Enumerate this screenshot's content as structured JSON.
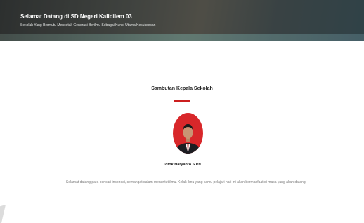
{
  "hero": {
    "title": "Selamat Datang di SD Negeri Kalidilem 03",
    "subtitle": "Sekolah Yang Bermutu Mencetak Generasi Berilmu Sebagai Kunci Utama Kesuksesan"
  },
  "principal_section": {
    "title": "Sambutan Kepala Sekolah",
    "name": "Totok Haryanto S.Pd",
    "message": "Selamat datang para pencari inspirasi, semangat dalam menuntut ilmu. Kelak ilmu yang kamu pelajari hari ini akan bermanfaat di masa yang akan datang."
  },
  "colors": {
    "accent": "#cc1f1f",
    "photo_background": "#d8272a"
  }
}
